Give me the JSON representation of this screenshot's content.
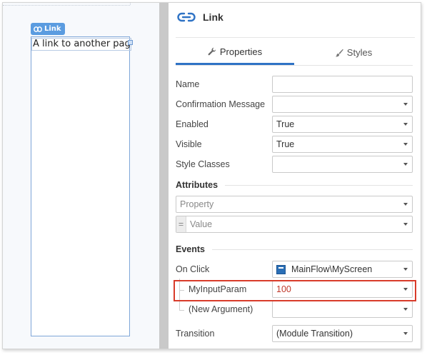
{
  "canvas": {
    "badge_label": "Link",
    "link_text": "A link to another page"
  },
  "panel": {
    "title": "Link",
    "tabs": [
      {
        "label": "Properties",
        "icon": "wrench-icon",
        "active": true
      },
      {
        "label": "Styles",
        "icon": "brush-icon",
        "active": false
      }
    ],
    "properties": [
      {
        "label": "Name",
        "value": "",
        "dropdown": false
      },
      {
        "label": "Confirmation Message",
        "value": "",
        "dropdown": true
      },
      {
        "label": "Enabled",
        "value": "True",
        "dropdown": true
      },
      {
        "label": "Visible",
        "value": "True",
        "dropdown": true
      },
      {
        "label": "Style Classes",
        "value": "",
        "dropdown": true
      }
    ],
    "attributes": {
      "heading": "Attributes",
      "property_placeholder": "Property",
      "value_placeholder": "Value",
      "eq_symbol": "="
    },
    "events": {
      "heading": "Events",
      "on_click_label": "On Click",
      "on_click_value": "MainFlow\\MyScreen",
      "param_label": "MyInputParam",
      "param_value": "100",
      "new_arg_label": "(New Argument)",
      "new_arg_value": "",
      "transition_label": "Transition",
      "transition_value": "(Module Transition)"
    }
  },
  "colors": {
    "accent": "#2f73c5",
    "badge": "#5b9ce0",
    "highlight": "#d83b2a",
    "param_value": "#c0392b"
  }
}
